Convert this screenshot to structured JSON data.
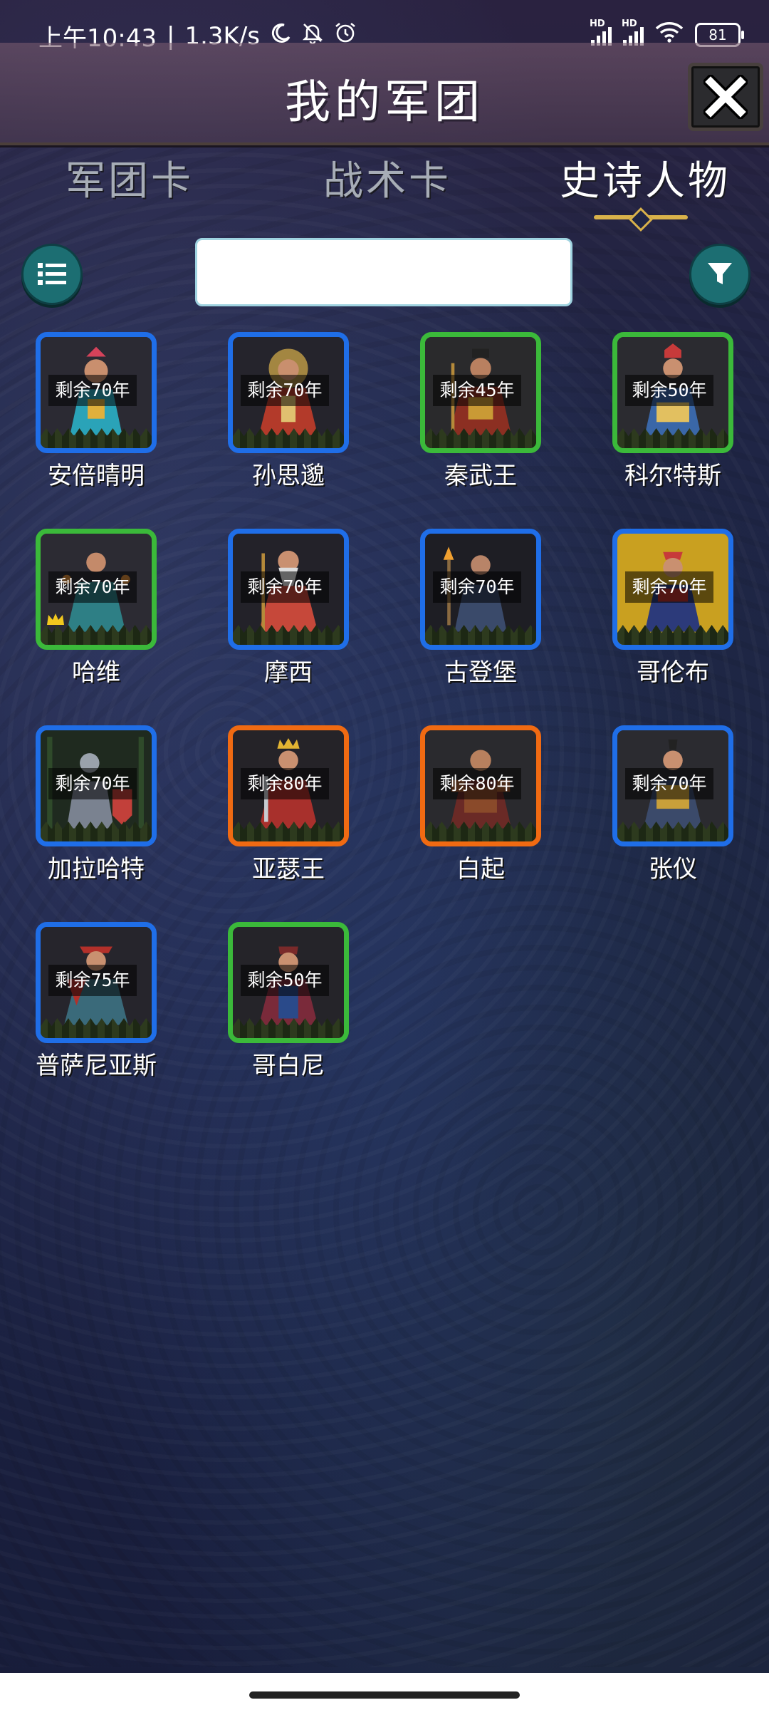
{
  "status_bar": {
    "time": "上午10:43",
    "net_speed": "1.3K/s",
    "battery": "81"
  },
  "header": {
    "title": "我的军团"
  },
  "tabs": [
    {
      "label": "军团卡"
    },
    {
      "label": "战术卡"
    },
    {
      "label": "史诗人物"
    }
  ],
  "search": {
    "value": "",
    "placeholder": ""
  },
  "cards": [
    {
      "name": "安倍晴明",
      "years": "剩余70年",
      "rarity": "blue"
    },
    {
      "name": "孙思邈",
      "years": "剩余70年",
      "rarity": "blue"
    },
    {
      "name": "秦武王",
      "years": "剩余45年",
      "rarity": "green"
    },
    {
      "name": "科尔特斯",
      "years": "剩余50年",
      "rarity": "green"
    },
    {
      "name": "哈维",
      "years": "剩余70年",
      "rarity": "green"
    },
    {
      "name": "摩西",
      "years": "剩余70年",
      "rarity": "blue"
    },
    {
      "name": "古登堡",
      "years": "剩余70年",
      "rarity": "blue"
    },
    {
      "name": "哥伦布",
      "years": "剩余70年",
      "rarity": "blue"
    },
    {
      "name": "加拉哈特",
      "years": "剩余70年",
      "rarity": "blue"
    },
    {
      "name": "亚瑟王",
      "years": "剩余80年",
      "rarity": "orange"
    },
    {
      "name": "白起",
      "years": "剩余80年",
      "rarity": "orange"
    },
    {
      "name": "张仪",
      "years": "剩余70年",
      "rarity": "blue"
    },
    {
      "name": "普萨尼亚斯",
      "years": "剩余75年",
      "rarity": "blue"
    },
    {
      "name": "哥白尼",
      "years": "剩余50年",
      "rarity": "green"
    }
  ],
  "colors": {
    "blue": "#1f6ee8",
    "green": "#3bb93a",
    "orange": "#f06a12",
    "accent": "#d9b24a",
    "button_teal": "#1c6e72"
  }
}
